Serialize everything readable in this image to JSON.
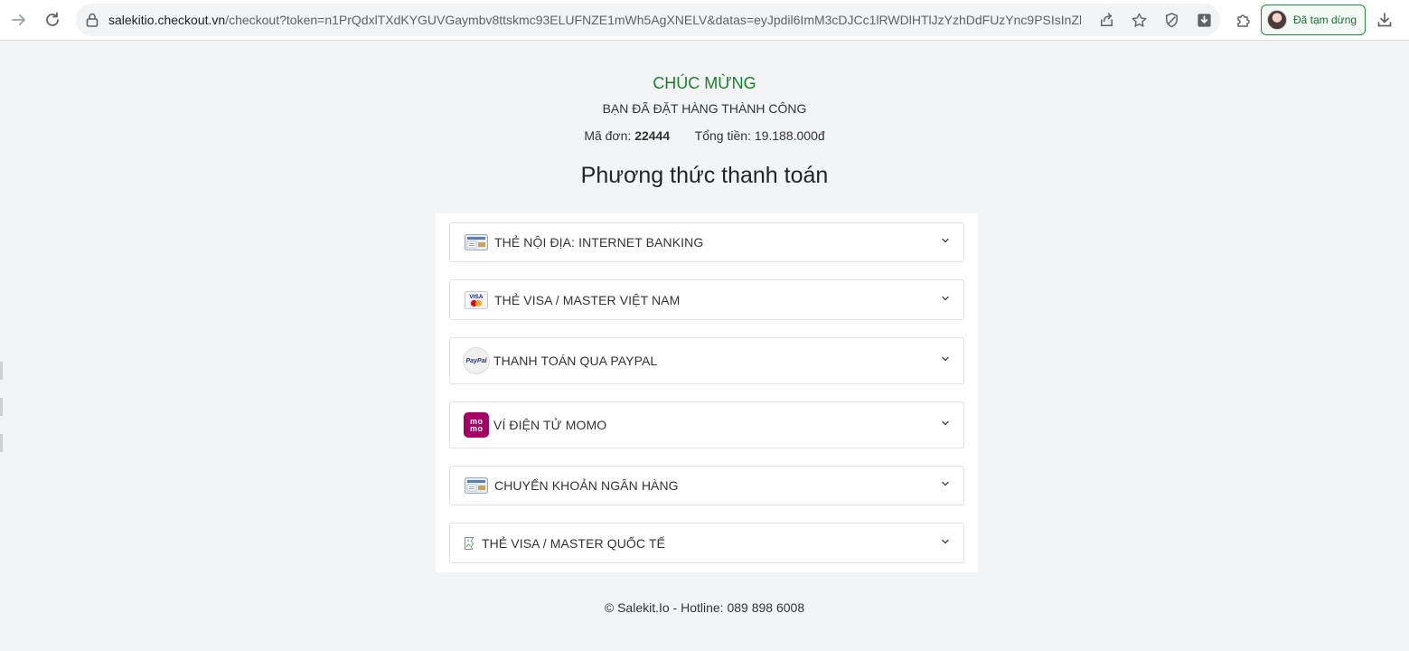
{
  "browser": {
    "url_host": "salekitio.checkout.vn",
    "url_rest": "/checkout?token=n1PrQdxlTXdKYGUVGaymbv8ttskmc93ELUFNZE1mWh5AgXNELV&datas=eyJpdil6ImM3cDJCc1lRWDlHTlJzYzhDdFUzYnc9PSIsInZhbHVlIj...",
    "profile_label": "Đã tạm dừng"
  },
  "order": {
    "congrats": "CHÚC MỪNG",
    "success": "BẠN ĐÃ ĐẶT HÀNG THÀNH CÔNG",
    "order_label": "Mã đơn:",
    "order_id": "22444",
    "total_label": "Tổng tiền:",
    "total_value": "19.188.000đ"
  },
  "payment": {
    "title": "Phương thức thanh toán",
    "methods": [
      {
        "label": "THẺ NỘI ĐỊA: INTERNET BANKING",
        "icon": "bank-card-icon"
      },
      {
        "label": "THẺ VISA / MASTER VIỆT NAM",
        "icon": "visa-master-icon"
      },
      {
        "label": "THANH TOÁN QUA PAYPAL",
        "icon": "paypal-icon",
        "icon_text": "PayPal"
      },
      {
        "label": "VÍ ĐIỆN TỬ MOMO",
        "icon": "momo-icon",
        "icon_text": "mo mo"
      },
      {
        "label": "CHUYỂN KHOẢN NGÂN HÀNG",
        "icon": "bank-transfer-icon"
      },
      {
        "label": "THẺ VISA / MASTER QUỐC TẾ",
        "icon": "broken-image-icon"
      }
    ]
  },
  "footer": {
    "text": "© Salekit.Io - Hotline: 089 898 6008"
  },
  "colors": {
    "accent_green": "#1a7f2a",
    "momo": "#a50064",
    "page_bg": "#f3f4f6"
  }
}
